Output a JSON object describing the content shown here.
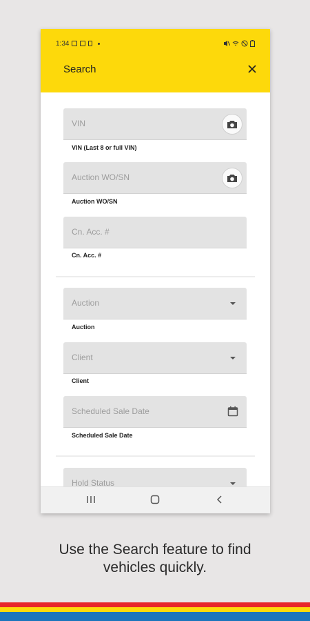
{
  "status_bar": {
    "time": "1:34"
  },
  "header": {
    "title": "Search",
    "close_icon": "close-icon",
    "bg_color": "#fdd90b"
  },
  "fields": [
    {
      "placeholder": "VIN",
      "label": "VIN (Last 8 or full VIN)",
      "trailing": "camera-icon"
    },
    {
      "placeholder": "Auction WO/SN",
      "label": "Auction WO/SN",
      "trailing": "camera-icon"
    },
    {
      "placeholder": "Cn. Acc. #",
      "label": "Cn. Acc. #",
      "trailing": ""
    },
    {
      "placeholder": "Auction",
      "label": "Auction",
      "trailing": "dropdown-arrow"
    },
    {
      "placeholder": "Client",
      "label": "Client",
      "trailing": "dropdown-arrow"
    },
    {
      "placeholder": "Scheduled Sale Date",
      "label": "Scheduled Sale Date",
      "trailing": "calendar-icon"
    },
    {
      "placeholder": "Hold Status",
      "label": "",
      "trailing": "dropdown-arrow"
    }
  ],
  "nav_bar": {
    "recents": "recents-icon",
    "home": "home-icon",
    "back": "back-icon"
  },
  "caption": {
    "line1": "Use the Search feature to find",
    "line2": "vehicles quickly."
  },
  "stripes": [
    "#e8262a",
    "#fdd90b",
    "#1b75bc"
  ]
}
